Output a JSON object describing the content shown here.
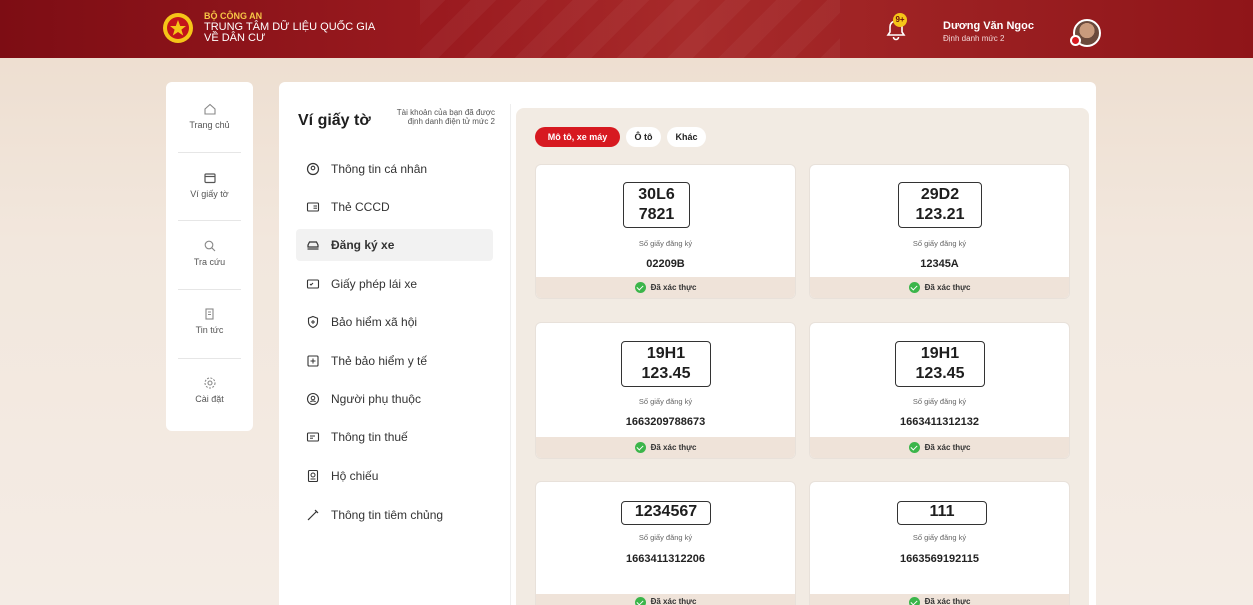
{
  "header": {
    "org_line1": "BỘ CÔNG AN",
    "org_line2": "TRUNG TÂM DỮ LIỆU QUỐC GIA",
    "org_line3": "VỀ DÂN CƯ",
    "notification_badge": "9+",
    "user_name": "Dương Văn Ngọc",
    "user_level": "Định danh mức 2",
    "brand_color": "#8f1519",
    "icons": {
      "emblem": "police-emblem-icon",
      "bell": "bell-icon",
      "avatar": "user-avatar"
    }
  },
  "rail": {
    "items": [
      {
        "label": "Trang chủ",
        "icon": "home-icon"
      },
      {
        "label": "Ví giấy tờ",
        "icon": "wallet-icon"
      },
      {
        "label": "Tra cứu",
        "icon": "search-icon"
      },
      {
        "label": "Tin tức",
        "icon": "news-icon"
      },
      {
        "label": "Cài đặt",
        "icon": "gear-icon"
      }
    ]
  },
  "wallet": {
    "title": "Ví giấy tờ",
    "note": "Tài khoản của bạn đã được định danh điện tử mức 2",
    "menu": [
      {
        "label": "Thông tin cá nhân",
        "icon": "user-circle-icon"
      },
      {
        "label": "Thẻ CCCD",
        "icon": "id-card-icon"
      },
      {
        "label": "Đăng ký xe",
        "icon": "car-icon",
        "active": true
      },
      {
        "label": "Giấy phép lái xe",
        "icon": "license-icon"
      },
      {
        "label": "Bảo hiểm xã hội",
        "icon": "shield-plus-icon"
      },
      {
        "label": "Thẻ bảo hiểm y tế",
        "icon": "medical-card-icon"
      },
      {
        "label": "Người phụ thuộc",
        "icon": "dependents-icon"
      },
      {
        "label": "Thông tin thuế",
        "icon": "tax-icon"
      },
      {
        "label": "Hộ chiếu",
        "icon": "passport-icon"
      },
      {
        "label": "Thông tin tiêm chủng",
        "icon": "syringe-icon"
      }
    ]
  },
  "filters": {
    "chips": [
      "Mô tô, xe máy",
      "Ô tô",
      "Khác"
    ],
    "selected": "Mô tô, xe máy",
    "accent": "#d71920"
  },
  "vehicles": {
    "reg_label": "Số giấy đăng ký",
    "verified_label": "Đã xác thực",
    "items": [
      {
        "plate_line1": "30L6",
        "plate_line2": "7821",
        "reg_no": "02209B"
      },
      {
        "plate_line1": "29D2",
        "plate_line2": "123.21",
        "reg_no": "12345A"
      },
      {
        "plate_line1": "19H1",
        "plate_line2": "123.45",
        "reg_no": "1663209788673"
      },
      {
        "plate_line1": "19H1",
        "plate_line2": "123.45",
        "reg_no": "1663411312132"
      },
      {
        "plate_line1": "1234567",
        "plate_line2": "",
        "reg_no": "1663411312206"
      },
      {
        "plate_line1": "111",
        "plate_line2": "",
        "reg_no": "1663569192115"
      }
    ]
  }
}
